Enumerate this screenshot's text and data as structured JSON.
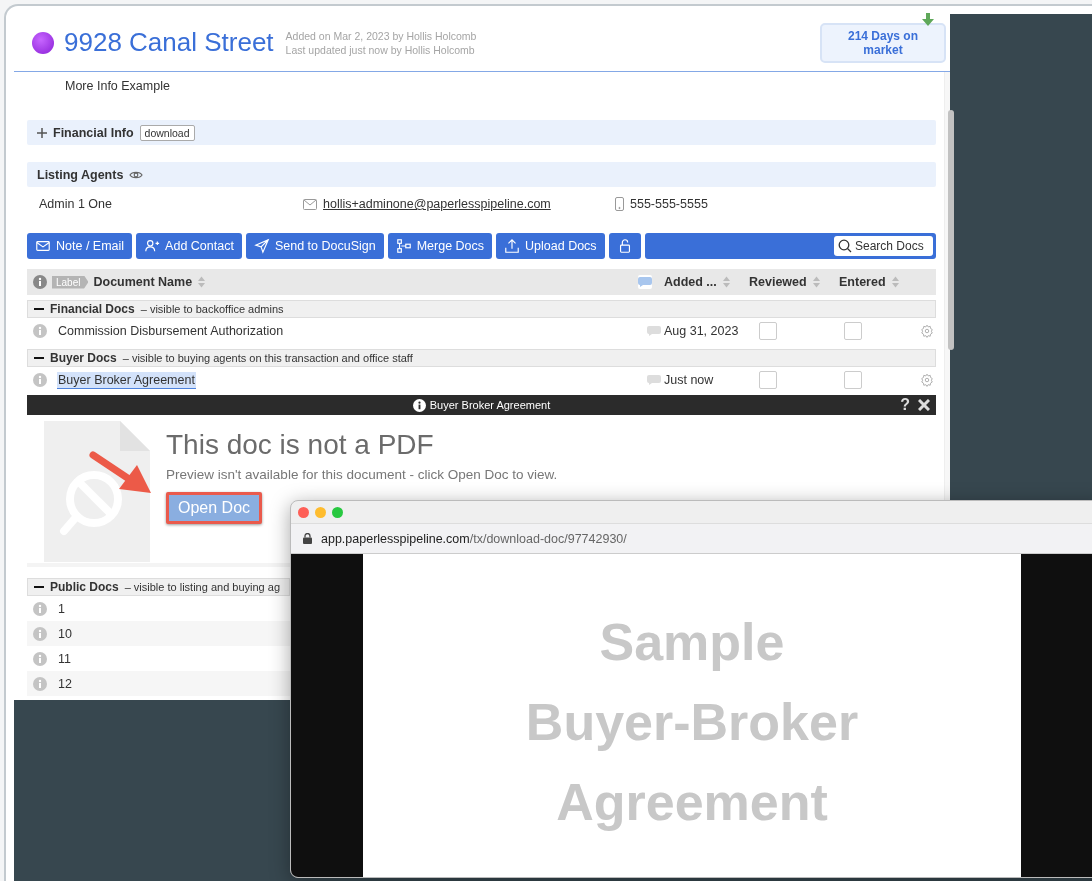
{
  "property": {
    "title": "9928 Canal Street",
    "added": "Added on Mar 2, 2023 by Hollis Holcomb",
    "updated": "Last updated just now by Hollis Holcomb",
    "days_on_market": "214 Days on market"
  },
  "more_info": [
    "More Info Example"
  ],
  "financial_info": {
    "title": "Financial Info",
    "expanded": false,
    "button": "download"
  },
  "listing_agents": {
    "title": "Listing Agents",
    "agents": [
      {
        "name": "Admin 1 One",
        "email": "hollis+adminone@paperlesspipeline.com",
        "phone": "555-555-5555"
      }
    ]
  },
  "toolbar": {
    "buttons": [
      {
        "kind": "mail",
        "label": "Note / Email"
      },
      {
        "kind": "contact",
        "label": "Add Contact"
      },
      {
        "kind": "send",
        "label": "Send to DocuSign"
      },
      {
        "kind": "merge",
        "label": "Merge Docs"
      },
      {
        "kind": "upload",
        "label": "Upload Docs"
      },
      {
        "kind": "lock"
      }
    ],
    "search": {
      "placeholder": "Search Docs"
    }
  },
  "table": {
    "label_tag": "Label",
    "columns": [
      {
        "label": "Document Name"
      },
      {
        "label": "Added ..."
      },
      {
        "label": "Reviewed"
      },
      {
        "label": "Entered"
      }
    ],
    "groups": [
      {
        "title": "Financial Docs",
        "description": "– visible to backoffice admins",
        "expanded": true,
        "rows": [
          {
            "name": "Commission Disbursement Authorization",
            "added": "Aug 31, 2023",
            "reviewed": false,
            "entered": false,
            "selected": false
          }
        ]
      },
      {
        "title": "Buyer Docs",
        "description": "– visible to buying agents on this transaction and office staff",
        "expanded": true,
        "rows": [
          {
            "name": "Buyer Broker Agreement",
            "added": "Just now",
            "reviewed": false,
            "entered": false,
            "selected": true
          }
        ]
      },
      {
        "title": "Public Docs",
        "description": "– visible to listing and buying ag",
        "expanded": true,
        "rows": [
          {
            "name": "1",
            "selected": false
          },
          {
            "name": "10",
            "selected": false
          },
          {
            "name": "11",
            "selected": false
          },
          {
            "name": "12",
            "selected": false
          }
        ]
      }
    ]
  },
  "preview": {
    "title": "Buyer Broker Agreement",
    "help": "?",
    "heading": "This doc is not a PDF",
    "message": "Preview isn't available for this document - click Open Doc to view.",
    "button": "Open Doc"
  },
  "popup": {
    "url_host": "app.paperlesspipeline.com",
    "url_path": "/tx/download-doc/97742930/",
    "document_lines": [
      "Sample",
      "Buyer-Broker",
      "Agreement"
    ]
  }
}
